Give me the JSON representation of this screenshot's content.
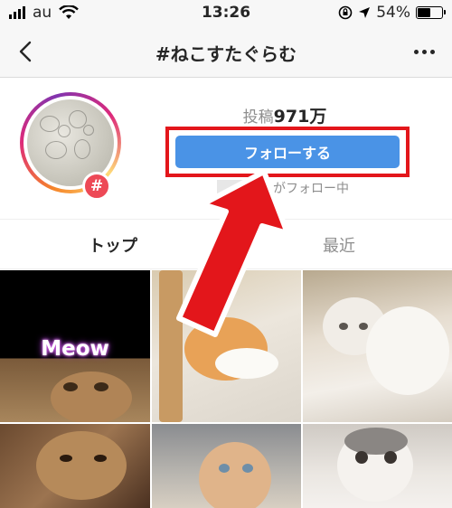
{
  "status_bar": {
    "carrier": "au",
    "time": "13:26",
    "battery_text": "54%",
    "battery_level": 0.54
  },
  "nav": {
    "title": "#ねこすたぐらむ"
  },
  "header": {
    "posts_label": "投稿",
    "posts_count": "971万",
    "follow_button": "フォローする",
    "followers_text": "がフォロー中",
    "hash_symbol": "#"
  },
  "tabs": {
    "top": "トップ",
    "recent": "最近"
  },
  "grid": {
    "meow_caption": "Meow"
  },
  "colors": {
    "follow_button": "#4a93e6",
    "highlight": "#e3161b",
    "badge": "#ed4956"
  },
  "icons": [
    "signal-icon",
    "wifi-icon",
    "lock-rotation-icon",
    "location-arrow-icon",
    "battery-icon",
    "back-chevron-icon",
    "more-dots-icon",
    "hashtag-icon"
  ]
}
